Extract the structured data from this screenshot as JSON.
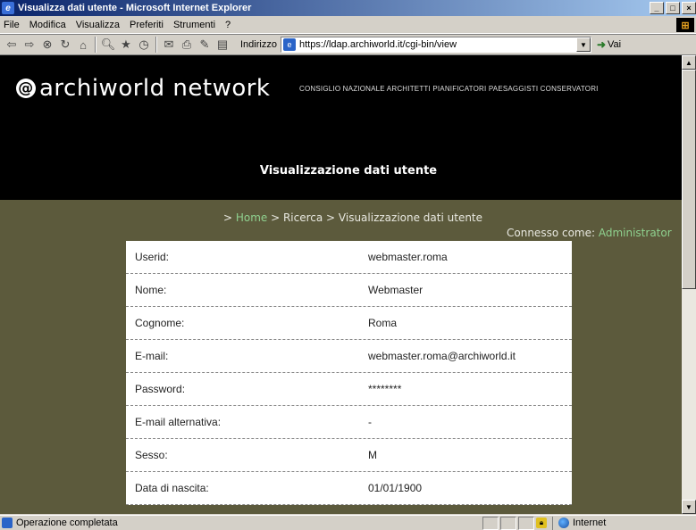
{
  "window": {
    "title": "Visualizza dati utente - Microsoft Internet Explorer",
    "buttons": {
      "minimize": "_",
      "maximize": "□",
      "close": "×"
    }
  },
  "menu": [
    "File",
    "Modifica",
    "Visualizza",
    "Preferiti",
    "Strumenti",
    "?"
  ],
  "toolbar": {
    "address_label": "Indirizzo",
    "address_url": "https://ldap.archiworld.it/cgi-bin/view",
    "go_label": "Vai",
    "icons": [
      "back-icon",
      "forward-icon",
      "stop-icon",
      "refresh-icon",
      "home-icon",
      "search-icon",
      "favorites-icon",
      "history-icon",
      "mail-icon",
      "print-icon",
      "edit-icon",
      "discuss-icon"
    ]
  },
  "site": {
    "logo": "archiworld network",
    "tagline": "CONSIGLIO NAZIONALE ARCHITETTI PIANIFICATORI PAESAGGISTI CONSERVATORI",
    "heading": "Visualizzazione dati utente"
  },
  "breadcrumb": {
    "prefix": "> ",
    "home": "Home",
    "sep1": " > ",
    "search": "Ricerca",
    "sep2": " > ",
    "current": "Visualizzazione dati utente"
  },
  "connection": {
    "label": "Connesso come: ",
    "user": "Administrator"
  },
  "user_data": {
    "rows": [
      {
        "label": "Userid:",
        "value": "webmaster.roma"
      },
      {
        "label": "Nome:",
        "value": "Webmaster"
      },
      {
        "label": "Cognome:",
        "value": "Roma"
      },
      {
        "label": "E-mail:",
        "value": "webmaster.roma@archiworld.it"
      },
      {
        "label": "Password:",
        "value": "********"
      },
      {
        "label": "E-mail alternativa:",
        "value": "-"
      },
      {
        "label": "Sesso:",
        "value": "M"
      },
      {
        "label": "Data di nascita:",
        "value": "01/01/1900"
      }
    ]
  },
  "status": {
    "text": "Operazione completata",
    "zone": "Internet"
  }
}
